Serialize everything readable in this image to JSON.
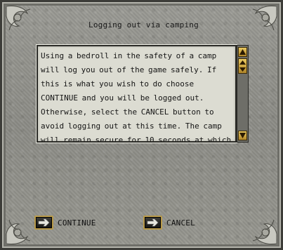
{
  "window": {
    "title": "Logging out via camping"
  },
  "message": {
    "text": "Using a bedroll in the safety of a camp will log you out of the game safely. If this is what you wish to do choose CONTINUE and you will be logged out. Otherwise, select the CANCEL button to avoid logging out at this time. The camp will remain secure for 10 seconds at which time this window will close"
  },
  "buttons": {
    "continue_label": "CONTINUE",
    "cancel_label": "CANCEL"
  },
  "colors": {
    "parchment": "#dcdcd2",
    "stone": "#8c8c86",
    "gold": "#b89a4a"
  },
  "icons": [
    "corner-ornament-icon",
    "scroll-up-arrow-icon",
    "scroll-down-arrow-icon",
    "scroll-thumb-icon",
    "hand-pointer-icon"
  ]
}
